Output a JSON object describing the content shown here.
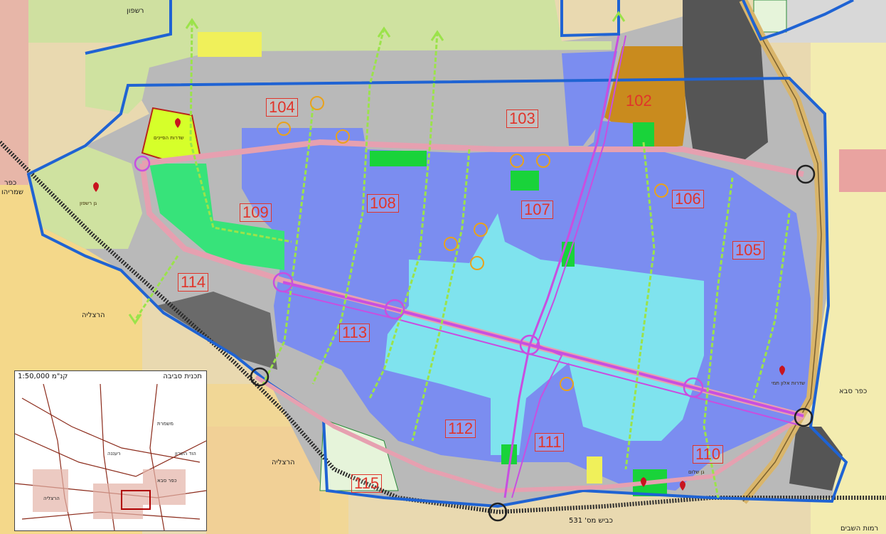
{
  "map": {
    "colors": {
      "background": "#e9d9b0",
      "residential_blue": "#7b8df0",
      "residential_light_blue": "#7fe3ee",
      "gray_zone": "#b9b9b9",
      "dark_gray_zone": "#555555",
      "green_field": "#cfe2a0",
      "park_green": "#37e37a",
      "public_green": "#19d33a",
      "brown_zone": "#c98b1e",
      "boundary_blue": "#1f63d3",
      "main_street_magenta": "#c84fe0",
      "green_path": "#9be34a",
      "railway": "#2b2b2b",
      "highway": "#d9b56a"
    },
    "zones": [
      {
        "id": "zone-104",
        "label": "104"
      },
      {
        "id": "zone-103",
        "label": "103"
      },
      {
        "id": "zone-102",
        "label": "102"
      },
      {
        "id": "zone-106",
        "label": "106"
      },
      {
        "id": "zone-108",
        "label": "108"
      },
      {
        "id": "zone-107",
        "label": "107"
      },
      {
        "id": "zone-109",
        "label": "109"
      },
      {
        "id": "zone-105",
        "label": "105"
      },
      {
        "id": "zone-114",
        "label": "114"
      },
      {
        "id": "zone-113",
        "label": "113"
      },
      {
        "id": "zone-112",
        "label": "112"
      },
      {
        "id": "zone-111",
        "label": "111"
      },
      {
        "id": "zone-110",
        "label": "110"
      },
      {
        "id": "zone-115",
        "label": "115"
      }
    ],
    "place_names": {
      "top_left": "רשפון",
      "left_kfar": "כפר\nשמריהו",
      "left_kfar_line1": "כפר",
      "left_kfar_line2": "שמריהו",
      "herzliya_left": "הרצליה",
      "herzliya_bottom": "הרצליה",
      "kfar_saba": "כפר סבא",
      "ramot_hashavim": "רמות השבים",
      "road_531": "כביש מס' 531"
    },
    "park_labels": {
      "park_left": "גן רשפון",
      "park_top": "שדרות הפיינים",
      "park_right": "שדרות אלון תמי",
      "park_bottom": "גן שלום"
    },
    "inset": {
      "title": "תכנית סביבה",
      "scale": "קנ\"מ 1:50,000",
      "labels": {
        "l1": "משמרת",
        "l2": "רעננה",
        "l3": "כפר סבא",
        "l4": "הרצליה",
        "l5": "הוד השרון"
      }
    }
  }
}
